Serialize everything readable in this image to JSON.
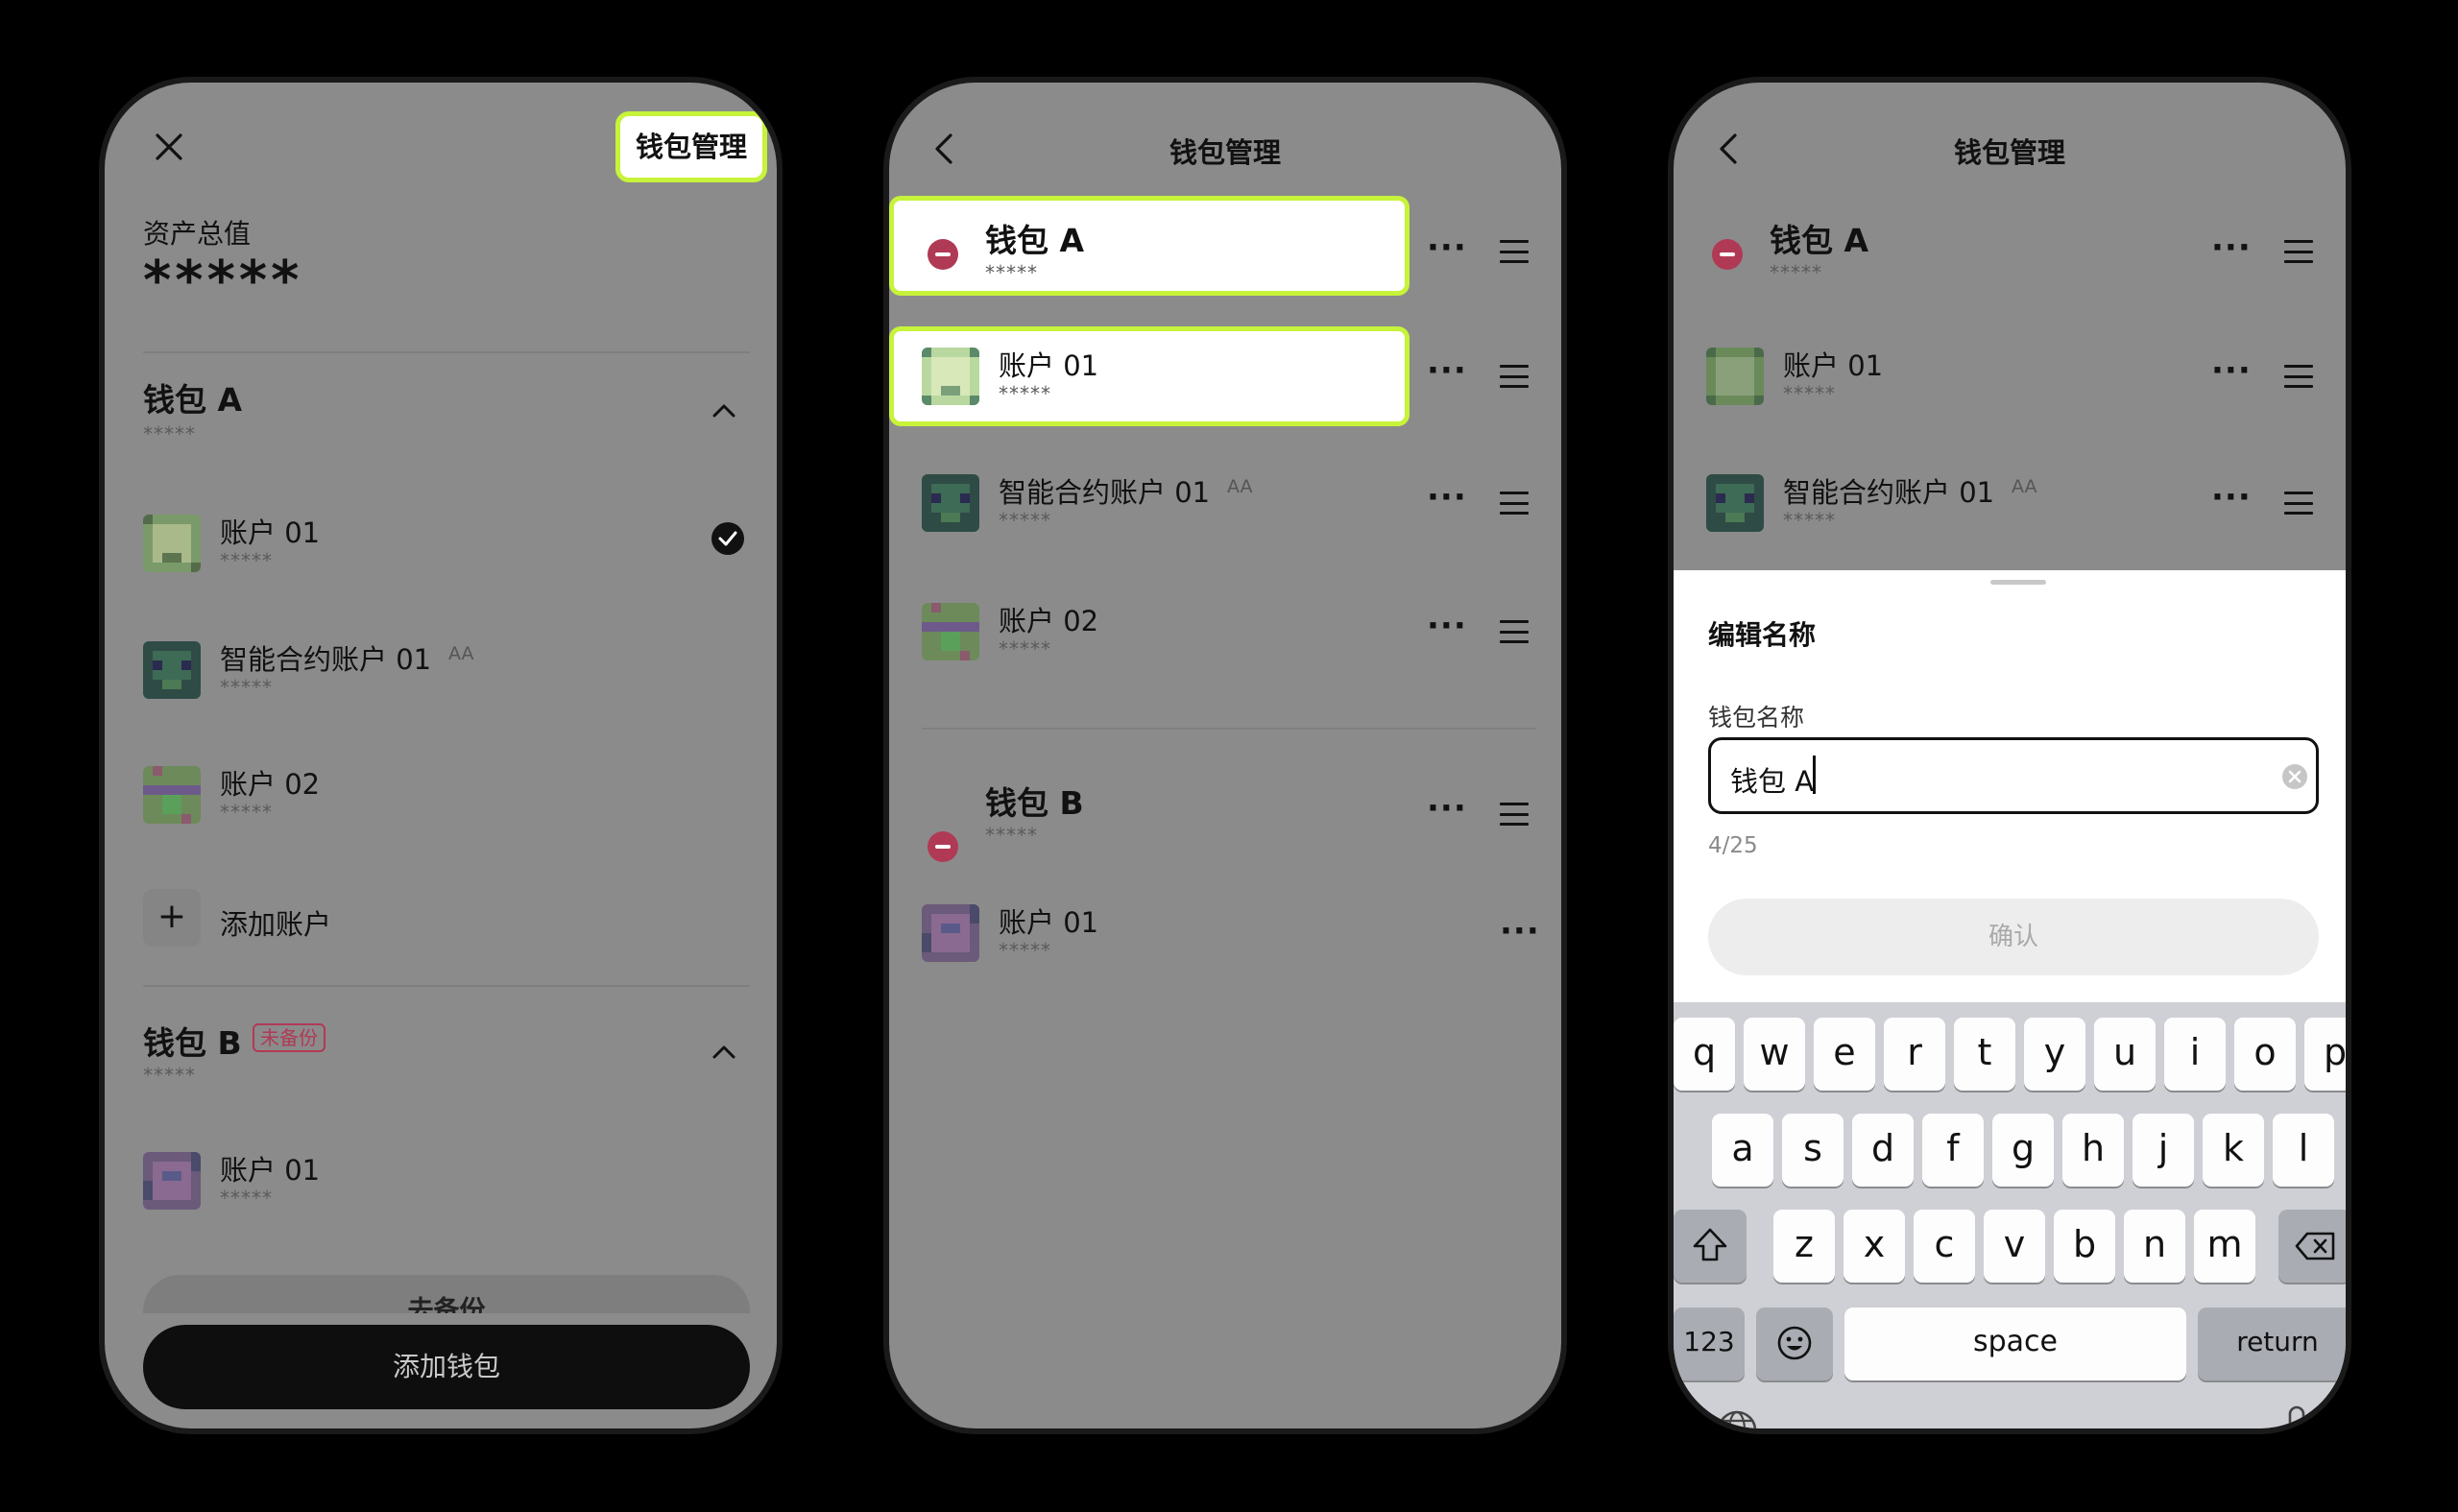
{
  "screen1": {
    "manage_button": "钱包管理",
    "total_label": "资产总值",
    "total_value": "*****",
    "wallet_a": {
      "name": "钱包 A",
      "mask": "*****",
      "accounts": [
        {
          "name": "账户 01",
          "mask": "*****",
          "selected": true
        },
        {
          "name": "智能合约账户 01",
          "tag": "AA",
          "mask": "*****"
        },
        {
          "name": "账户 02",
          "mask": "*****"
        }
      ],
      "add_account": "添加账户"
    },
    "wallet_b": {
      "name": "钱包 B",
      "badge": "未备份",
      "mask": "*****",
      "accounts": [
        {
          "name": "账户 01",
          "mask": "*****"
        }
      ],
      "backup_label": "去备份"
    },
    "add_wallet": "添加钱包",
    "badge_color": "#b03a55"
  },
  "screen2": {
    "title": "钱包管理",
    "wallet_a": {
      "name": "钱包 A",
      "mask": "*****"
    },
    "accounts": [
      {
        "name": "账户 01",
        "mask": "*****"
      },
      {
        "name": "智能合约账户 01",
        "tag": "AA",
        "mask": "*****"
      },
      {
        "name": "账户 02",
        "mask": "*****"
      }
    ],
    "wallet_b": {
      "name": "钱包 B",
      "mask": "*****"
    },
    "wallet_b_accounts": [
      {
        "name": "账户 01",
        "mask": "*****"
      }
    ],
    "highlight_color": "#c7f33a"
  },
  "screen3": {
    "title": "钱包管理",
    "wallet_a": {
      "name": "钱包 A",
      "mask": "*****"
    },
    "accounts": [
      {
        "name": "账户 01",
        "mask": "*****"
      },
      {
        "name": "智能合约账户 01",
        "tag": "AA",
        "mask": "*****"
      }
    ],
    "sheet": {
      "title": "编辑名称",
      "field_label": "钱包名称",
      "field_value": "钱包 A",
      "counter": "4/25",
      "confirm": "确认"
    },
    "keyboard": {
      "row1": [
        "q",
        "w",
        "e",
        "r",
        "t",
        "y",
        "u",
        "i",
        "o",
        "p"
      ],
      "row2": [
        "a",
        "s",
        "d",
        "f",
        "g",
        "h",
        "j",
        "k",
        "l"
      ],
      "row3": [
        "z",
        "x",
        "c",
        "v",
        "b",
        "n",
        "m"
      ],
      "numbers": "123",
      "space": "space",
      "return": "return"
    }
  },
  "icons": {
    "close": "close-icon",
    "back": "chevron-left-icon",
    "collapse": "chevron-up-icon",
    "check": "check-circle-icon",
    "more": "more-dots-icon",
    "drag": "drag-handle-icon",
    "remove": "remove-circle-icon",
    "add": "plus-icon",
    "clear": "clear-input-icon",
    "shift": "shift-icon",
    "backspace": "backspace-icon",
    "emoji": "emoji-icon",
    "globe": "globe-icon",
    "mic": "mic-icon"
  }
}
